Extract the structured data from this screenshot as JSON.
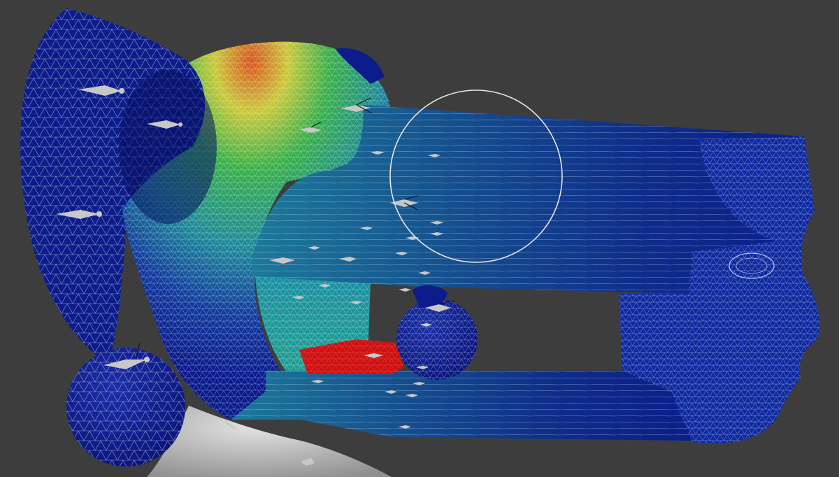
{
  "viewport": {
    "background_color": "#3d3d3d",
    "mode": "weight-paint",
    "overlay": "wireframe"
  },
  "weight_gradient": {
    "zero": "#0a1a8c",
    "low": "#123a9e",
    "mid_low": "#1f8a9a",
    "mid": "#39b04a",
    "mid_high": "#c9c93a",
    "high": "#d8551f",
    "full": "#d01010"
  },
  "brush": {
    "shape": "circle",
    "outline_color": "#e6e6e6"
  },
  "bone_color": "#c8c8c8",
  "neck_color": "#b7b7b7",
  "objects": [
    "jester-hat-mesh",
    "head-mesh",
    "neck-mesh",
    "armature-bones",
    "brush-cursor"
  ]
}
